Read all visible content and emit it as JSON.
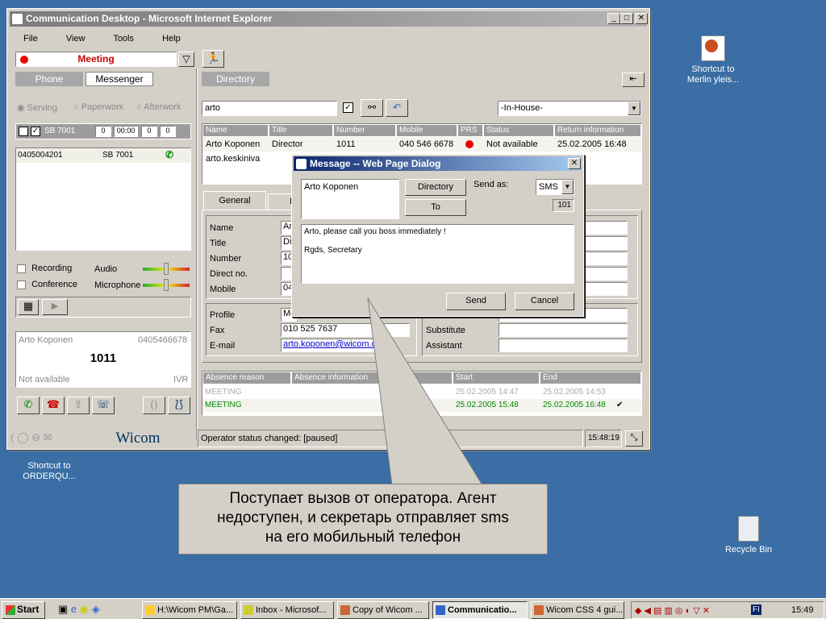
{
  "window": {
    "title": "Communication Desktop - Microsoft Internet Explorer",
    "min": "_",
    "max": "□",
    "close": "✕"
  },
  "menu": [
    "File",
    "View",
    "Tools",
    "Help"
  ],
  "status": {
    "value": "Meeting"
  },
  "tabs": {
    "phone": "Phone",
    "messenger": "Messenger",
    "directory": "Directory"
  },
  "modes": [
    "Serving",
    "Paperwork",
    "Afterwork"
  ],
  "line": {
    "label": "SB 7001",
    "c1": "0",
    "time": "00:00",
    "c2": "0",
    "c3": "0"
  },
  "call": {
    "number": "0405004201",
    "ext": "SB 7001"
  },
  "options": {
    "recording": "Recording",
    "conference": "Conference",
    "audio": "Audio",
    "microphone": "Microphone"
  },
  "caller": {
    "name": "Arto Koponen",
    "phone": "0405466678",
    "ext": "1011",
    "status": "Not available",
    "ivr": "IVR"
  },
  "brand": "Wicom",
  "search": {
    "value": "arto",
    "scope": "-In-House-"
  },
  "table": {
    "headers": [
      "Name",
      "Title",
      "Number",
      "Mobile",
      "PRS",
      "Status",
      "Return information"
    ],
    "rows": [
      [
        "Arto Koponen",
        "Director",
        "1011",
        "040 546 6678",
        "",
        "Not available",
        "25.02.2005 16:48"
      ],
      [
        "arto.keskiniva",
        "",
        "",
        "",
        "",
        "",
        ""
      ]
    ]
  },
  "detail": {
    "tab": "General",
    "tab2": "I",
    "labels": [
      "Name",
      "Title",
      "Number",
      "Direct no.",
      "Mobile"
    ],
    "values": [
      "Ar",
      "Dir",
      "10",
      "",
      "04"
    ],
    "labels2": [
      "Profile",
      "Fax",
      "E-mail"
    ],
    "values2": [
      "Me",
      "010 525 7637",
      "arto.koponen@wicom.c"
    ],
    "labels3": [
      "Substitute",
      "Assistant"
    ]
  },
  "absence": {
    "headers": [
      "Absence reason",
      "Absence information",
      "",
      "Start",
      "End"
    ],
    "rows": [
      [
        "MEETING",
        "",
        "",
        "25.02.2005 14:47",
        "25.02.2005 14:53"
      ],
      [
        "MEETING",
        "",
        "",
        "25.02.2005 15:48",
        "25.02.2005 16:48"
      ]
    ]
  },
  "statusbar": {
    "text": "Operator status changed: [paused]",
    "time": "15:48:19"
  },
  "dialog": {
    "title": "Message -- Web Page Dialog",
    "recipient": "Arto Koponen",
    "directory": "Directory",
    "to": "To",
    "sendas": "Send as:",
    "type": "SMS",
    "count": "101",
    "line1": "Arto, please call you boss immediately !",
    "line2": "Rgds, Secretary",
    "send": "Send",
    "cancel": "Cancel"
  },
  "callout": {
    "l1": "Поступает вызов от оператора. Агент",
    "l2": "недоступен, и секретарь отправляет sms",
    "l3": "на его мобильный телефон"
  },
  "desktop": {
    "merlin1": "Shortcut to",
    "merlin2": "Merlin yleis...",
    "order1": "Shortcut to",
    "order2": "ORDERQU...",
    "recycle": "Recycle Bin"
  },
  "taskbar": {
    "start": "Start",
    "items": [
      "H:\\Wicom PM\\Ga...",
      "Inbox - Microsof...",
      "Copy of Wicom ...",
      "Communicatio...",
      "Wicom CSS 4 gui..."
    ],
    "lang": "FI",
    "clock": "15:49"
  }
}
